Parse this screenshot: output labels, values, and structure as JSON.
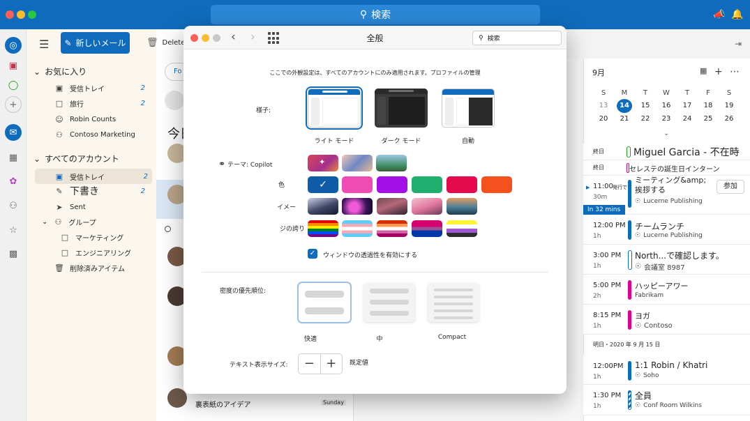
{
  "titlebar": {
    "search_label": "検索"
  },
  "folders": {
    "new_mail_label": "新しいメール",
    "delete_label": "Delete",
    "favorites_label": "お気に入り",
    "favorites": [
      {
        "label": "受信トレイ",
        "count": "2"
      },
      {
        "label": "旅行",
        "count": "2"
      },
      {
        "label": "Robin Counts",
        "count": ""
      },
      {
        "label": "Contoso Marketing",
        "count": ""
      }
    ],
    "all_accounts_label": "すべてのアカウント",
    "accounts": [
      {
        "label": "受信トレイ",
        "count": "2"
      },
      {
        "label": "下書き",
        "count": "2"
      },
      {
        "label": "Sent",
        "count": ""
      },
      {
        "label": "グループ",
        "count": ""
      },
      {
        "label": "マーケティング",
        "count": ""
      },
      {
        "label": "エンジニアリング",
        "count": ""
      },
      {
        "label": "削除済みアイテム",
        "count": ""
      }
    ]
  },
  "maillist": {
    "focused_tab": "Fo",
    "today_header": "今日",
    "last_subject": "裏表紙のアイデア",
    "last_day": "Sunday"
  },
  "calendar": {
    "month": "9月",
    "weekdays": [
      "S",
      "M",
      "T",
      "W",
      "T",
      "F",
      "S"
    ],
    "weeks": [
      [
        "13",
        "14",
        "15",
        "16",
        "17",
        "18",
        "19"
      ],
      [
        "20",
        "21",
        "22",
        "23",
        "24",
        "25",
        "26"
      ]
    ],
    "today": "14",
    "in_32_label": "In 32 mins",
    "tomorrow_label": "明日・2020 年 9 月 15 日",
    "events": [
      {
        "time": "終日",
        "duration": "",
        "title": "Miguel Garcia - 不在時",
        "location": "",
        "color": "#13a10e",
        "bar_style": "outline"
      },
      {
        "time": "終日",
        "duration": "",
        "title": "セレステの誕生日インターン",
        "location": "",
        "color": "#e3008c",
        "bar_style": "outline-small"
      },
      {
        "time": "11:00",
        "duration": "30m",
        "title": "ミーティング&amp;\n挨拶する",
        "location": "Lucerne Publishing",
        "color": "#0f6cbd",
        "bar_style": "solid",
        "join_label": "参加",
        "overlay": "発行です"
      },
      {
        "time": "12:00 PM",
        "duration": "1h",
        "title": "チームランチ",
        "location": "Lucerne Publishing",
        "color": "#0f6cbd",
        "bar_style": "solid"
      },
      {
        "time": "3:00 PM",
        "duration": "1h",
        "title": "North...で確認します。",
        "location": "会議室 8987",
        "color": "#0f6cbd",
        "bar_style": "outline"
      },
      {
        "time": "5:00 PM",
        "duration": "2h",
        "title": "ハッピーアワー",
        "location": "Fabrikam",
        "color": "#e3008c",
        "bar_style": "solid"
      },
      {
        "time": "8:15 PM",
        "duration": "1h",
        "title": "ヨガ",
        "location": "Contoso",
        "color": "#e3008c",
        "bar_style": "solid"
      },
      {
        "time": "12:00PM",
        "duration": "1h",
        "title": "1:1 Robin / Khatri",
        "location": "Soho",
        "color": "#0f6cbd",
        "bar_style": "solid"
      },
      {
        "time": "1:30 PM",
        "duration": "1h",
        "title": "全員",
        "location": "Conf Room Wilkins",
        "color": "#0f6cbd",
        "bar_style": "striped"
      }
    ]
  },
  "settings": {
    "title": "全般",
    "search_placeholder": "検索",
    "notice": "ここでの外観設定は、すべてのアカウントにのみ適用されます。プロファイルの管理",
    "appearance_label": "様子:",
    "modes": [
      {
        "label": "ライト モード",
        "selected": true
      },
      {
        "label": "ダーク モード",
        "selected": false
      },
      {
        "label": "自動",
        "selected": false
      }
    ],
    "theme_label": "テーマ: Copilot",
    "color_label": "色",
    "image_label": "イメー",
    "pride_label": "ジの誇り",
    "colors": [
      "#0f5ca8",
      "#f04ab4",
      "#a40fe8",
      "#1fae6e",
      "#e5094e",
      "#f4511e"
    ],
    "transparency_label": "ウィンドウの透過性を有効にする",
    "density_label": "密度の優先順位:",
    "densities": [
      {
        "label": "快適",
        "selected": true
      },
      {
        "label": "中",
        "selected": false
      },
      {
        "label": "Compact",
        "selected": false
      }
    ],
    "text_size_label": "テキスト表示サイズ:",
    "minus_label": "−",
    "plus_label": "+",
    "default_label": "既定値"
  }
}
